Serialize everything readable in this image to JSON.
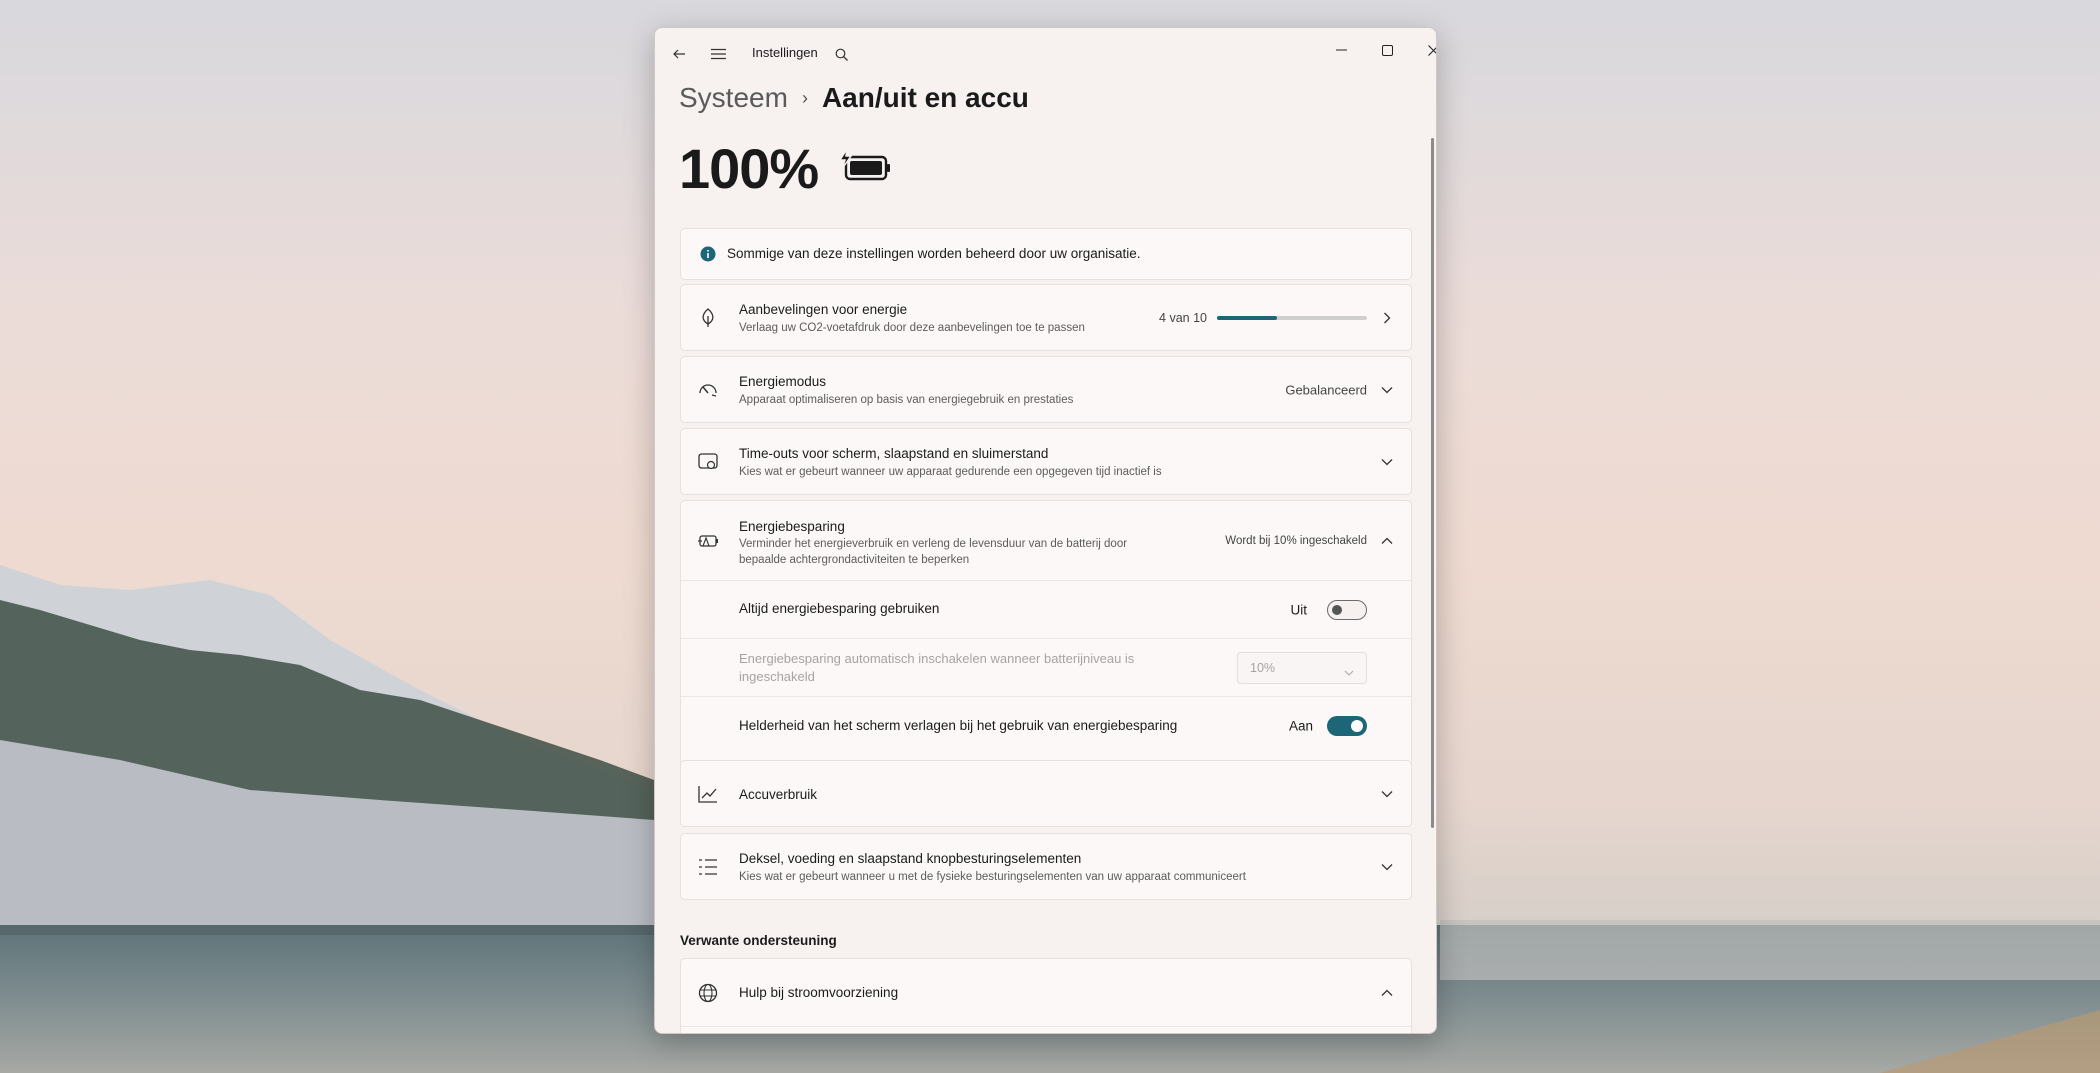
{
  "window": {
    "app_title": "Instellingen",
    "icons": [
      "back-arrow-icon",
      "hamburger-menu-icon",
      "search-icon",
      "minimize-icon",
      "maximize-icon",
      "close-icon"
    ]
  },
  "breadcrumb": {
    "parent": "Systeem",
    "separator": "›",
    "current": "Aan/uit en accu"
  },
  "battery": {
    "percentage": "100%",
    "icon": "battery-charging-icon"
  },
  "info_banner": {
    "text": "Sommige van deze instellingen worden beheerd door uw organisatie.",
    "icon": "info-icon"
  },
  "rows": {
    "energy_recommendations": {
      "title": "Aanbevelingen voor energie",
      "subtitle": "Verlaag uw CO2-voetafdruk door deze aanbevelingen toe te passen",
      "progress_text": "4 van 10",
      "progress_fraction": 0.4,
      "icon": "leaf-icon"
    },
    "power_mode": {
      "title": "Energiemodus",
      "subtitle": "Apparaat optimaliseren op basis van energiegebruik en prestaties",
      "value": "Gebalanceerd",
      "icon": "power-mode-icon"
    },
    "timeouts": {
      "title": "Time-outs voor scherm, slaapstand en sluimerstand",
      "subtitle": "Kies wat er gebeurt wanneer uw apparaat gedurende een opgegeven tijd inactief is",
      "icon": "screen-sleep-icon"
    },
    "energy_saver": {
      "title": "Energiebesparing",
      "subtitle": "Verminder het energieverbruik en verleng de levensduur van de batterij door bepaalde achtergrondactiviteiten te beperken",
      "status": "Wordt bij 10% ingeschakeld",
      "icon": "energy-saver-icon",
      "always_use": {
        "label": "Altijd energiebesparing gebruiken",
        "state_text": "Uit",
        "on": false
      },
      "auto_enable": {
        "label": "Energiebesparing automatisch inschakelen wanneer batterijniveau is ingeschakeld",
        "value": "10%"
      },
      "lower_brightness": {
        "label": "Helderheid van het scherm verlagen bij het gebruik van energiebesparing",
        "state_text": "Aan",
        "on": true
      }
    },
    "battery_usage": {
      "title": "Accuverbruik",
      "icon": "chart-line-icon"
    },
    "lid_power": {
      "title": "Deksel, voeding en slaapstand knopbesturingselementen",
      "subtitle": "Kies wat er gebeurt wanneer u met de fysieke besturingselementen van uw apparaat communiceert",
      "icon": "list-icon"
    }
  },
  "related": {
    "heading": "Verwante ondersteuning",
    "help_power": {
      "title": "Hulp bij stroomvoorziening",
      "icon": "globe-icon"
    }
  },
  "colors": {
    "accent": "#1c6678",
    "window_bg": "#f7f1ef",
    "card_bg": "#fbf8f7"
  }
}
